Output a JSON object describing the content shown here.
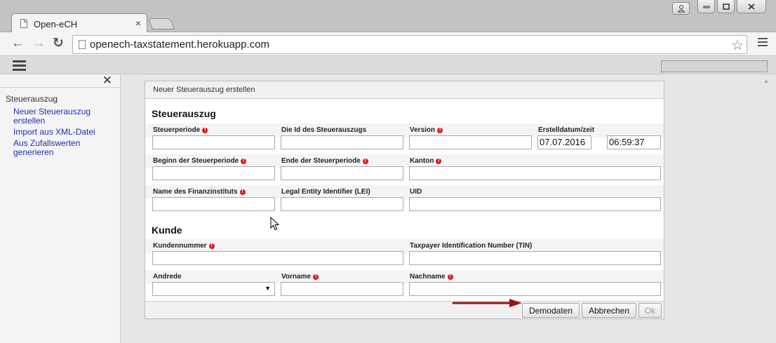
{
  "browser": {
    "tab_title": "Open-eCH",
    "tab_close": "×",
    "url": "openech-taxstatement.herokuapp.com",
    "back": "←",
    "forward": "→",
    "reload": "↻",
    "star": "☆"
  },
  "sidebar": {
    "close": "✕",
    "section": "Steuerauszug",
    "links": [
      "Neuer Steuerauszug erstellen",
      "Import aus XML-Datei",
      "Aus Zufallswerten generieren"
    ]
  },
  "dialog": {
    "title": "Neuer Steuerauszug erstellen",
    "section1": "Steuerauszug",
    "section2": "Kunde",
    "labels": {
      "steuerperiode": "Steuerperiode",
      "id": "Die Id des Steuerauszugs",
      "version": "Version",
      "erstelldatum": "Erstelldatum/zeit",
      "beginn": "Beginn der Steuerperiode",
      "ende": "Ende der Steuerperiode",
      "kanton": "Kanton",
      "finanzinstitut": "Name des Finanzinstituts",
      "lei": "Legal Entity Identifier (LEI)",
      "uid": "UID",
      "kundennummer": "Kundennummer",
      "tin": "Taxpayer Identification Number (TIN)",
      "anrede": "Andrede",
      "vorname": "Vorname",
      "nachname": "Nachname"
    },
    "values": {
      "datum": "07.07.2016",
      "zeit": "06:59:37"
    },
    "required_mark": "!",
    "buttons": {
      "demodaten": "Demodaten",
      "abbrechen": "Abbrechen",
      "ok": "Ok"
    }
  },
  "colors": {
    "link": "#1b2fb6",
    "required": "#e01818",
    "annotation_arrow": "#9b1111"
  }
}
